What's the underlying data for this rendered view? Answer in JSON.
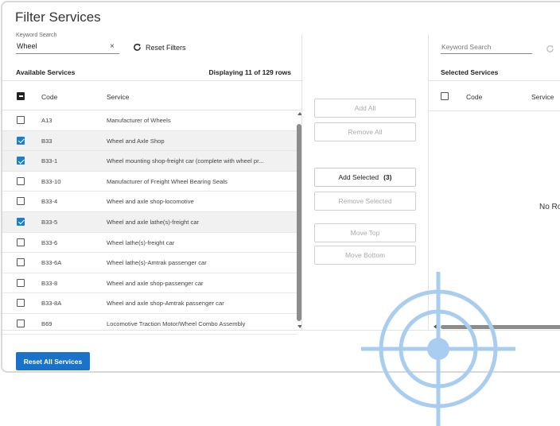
{
  "title": "Filter Services",
  "left": {
    "keyword_label": "Keyword Search",
    "keyword_value": "Wheel",
    "clear_symbol": "×",
    "reset_filters": "Reset Filters",
    "panel_title": "Available Services",
    "displaying": "Displaying 11 of 129 rows",
    "headers": {
      "code": "Code",
      "service": "Service"
    },
    "rows": [
      {
        "code": "A13",
        "service": "Manufacturer of Wheels",
        "selected": false
      },
      {
        "code": "B33",
        "service": "Wheel and Axle Shop",
        "selected": true
      },
      {
        "code": "B33-1",
        "service": "Wheel mounting shop-freight car (complete with wheel pr...",
        "selected": true
      },
      {
        "code": "B33-10",
        "service": "Manufacturer of Freight Wheel Bearing Seals",
        "selected": false
      },
      {
        "code": "B33-4",
        "service": "Wheel and axle shop-locomotive",
        "selected": false
      },
      {
        "code": "B33-5",
        "service": "Wheel and axle lathe(s)-freight car",
        "selected": true
      },
      {
        "code": "B33-6",
        "service": "Wheel lathe(s)-freight car",
        "selected": false
      },
      {
        "code": "B33-6A",
        "service": "Wheel lathe(s)-Amtrak passenger car",
        "selected": false
      },
      {
        "code": "B33-8",
        "service": "Wheel and axle shop-passenger car",
        "selected": false
      },
      {
        "code": "B33-8A",
        "service": "Wheel and axle shop-Amtrak passenger car",
        "selected": false
      },
      {
        "code": "B69",
        "service": "Locomotive Traction Motor/Wheel Combo Assembly",
        "selected": false
      }
    ]
  },
  "middle": {
    "add_all": "Add All",
    "remove_all": "Remove All",
    "add_selected": "Add Selected",
    "add_selected_count": "(3)",
    "remove_selected": "Remove Selected",
    "move_top": "Move Top",
    "move_bottom": "Move Bottom"
  },
  "right": {
    "keyword_placeholder": "Keyword Search",
    "panel_title": "Selected Services",
    "headers": {
      "code": "Code",
      "service": "Service"
    },
    "empty_text": "No Ro"
  },
  "footer": {
    "reset_all": "Reset All Services"
  },
  "colors": {
    "accent": "#1a73c8",
    "checkbox": "#1a7fd0",
    "target_overlay": "#a9cdf0"
  },
  "icons": {
    "refresh": "refresh-icon",
    "clear": "close-icon",
    "target": "crosshair-target-icon"
  }
}
